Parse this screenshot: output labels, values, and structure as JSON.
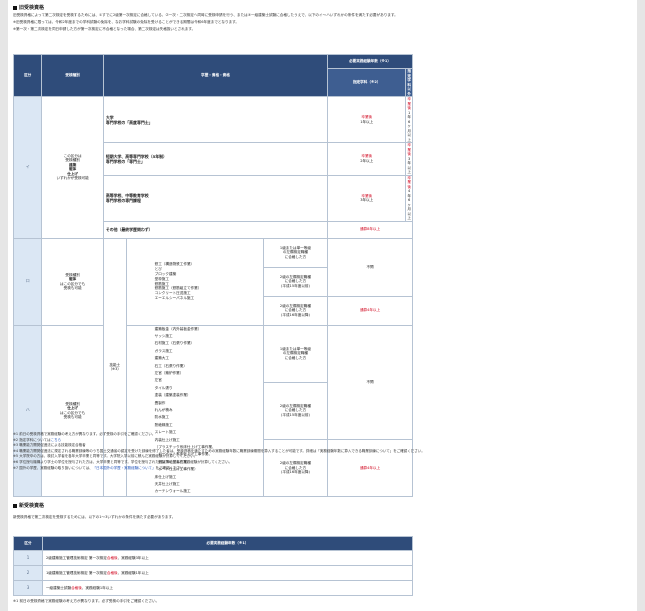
{
  "s1": {
    "title": "旧受検資格",
    "intro1": "旧受検資格によって第二次検定を受検するためには、①すでに2級第一次検定に合格している、②一次・二次検定へ同時に受検申請を行う、または③一級建築士試験に合格したうえで、以下のイ〜ハいずれかの条件を満たす必要があります。",
    "intro2": "※旧受検資格に限っては、令和2年度までの学科試験の免除を、なお学科試験の免除を受けることができる期間は令和6年度までとなります。",
    "intro3": "※第一次・第二次検定を同日申請した方が第一次検定に不合格となった場合、第二次検定は失格扱いとされます。"
  },
  "table1": {
    "h_kubun": "区分",
    "h_shubetsu": "受検種別",
    "h_gakureki": "学歴・資格・資格",
    "h_jitsumu": "必要実務経験年数（※1）",
    "h_shitei": "指定学科（※2）",
    "h_shitei_igai": "指定学科以外",
    "i_label": "イ",
    "i_shubetsu": [
      "この区分は",
      "受検種別",
      "建築",
      "躯体",
      "仕上げ",
      "いずれかが受検可能"
    ],
    "rows_i": [
      {
        "l1": "大学",
        "l2": "専門学校の「高度専門士」",
        "s_a": "卒業後",
        "s_b": "1年以上",
        "o_a": "卒業後",
        "o_b": "1年6ヶ月以上"
      },
      {
        "l1": "短期大学、高等専門学校（5年制）",
        "l2": "専門学校の「専門士」",
        "s_a": "卒業後",
        "s_b": "2年以上",
        "o_a": "卒業後",
        "o_b": "3年以上"
      },
      {
        "l1": "高等学校、中等教育学校",
        "l2": "専門学校の専門課程",
        "s_a": "卒業後",
        "s_b": "3年以上",
        "o_a": "卒業後",
        "o_b": "4年6ヶ月以上"
      }
    ],
    "sonota": "その他（最終学歴問わず）",
    "sonota_val": "通算8年以上",
    "ro_label": "ロ",
    "ro_shubetsu": [
      "受検種別",
      "躯体",
      "はこの区分でも",
      "受検も可能"
    ],
    "ha_label": "ハ",
    "ha_shubetsu": [
      "受検種別",
      "仕上げ",
      "はこの区分でも",
      "受検も可能"
    ],
    "ginou": [
      "技能士",
      "（※3）"
    ],
    "ro_trades": [
      "鉄工（構造物鉄工作業）",
      "とび",
      "ブロック建築",
      "型枠施工",
      "鉄筋施工",
      "鉄筋施工（鉄筋組立て作業）",
      "コンクリート圧送施工",
      "エーエルシーパネル施工"
    ],
    "ha_trades": [
      "建築板金（内外装板金作業）",
      "サッシ施工",
      "石材施工（石張り作業）",
      "ガラス施工",
      "建築大工",
      "石工（石張り作業）",
      "左官（築炉作業）",
      "左官",
      "タイル張り",
      "塗装（建築塗装作業）",
      "畳製作",
      "れんが積み",
      "防水施工",
      "熱絶縁施工",
      "スレート施工",
      "内装仕上げ施工",
      "（プラスチック系床仕上げ工事作業、",
      "　カーペット系床仕上げ工事作業、",
      "　鋼製下地工事作業、",
      "　ボード仕上げ工事作業）",
      "床仕上げ施工",
      "天井仕上げ施工",
      "カーテンウォール施工"
    ],
    "q1": [
      "1級または単一等級",
      "の左欄検定職種",
      "に合格した方"
    ],
    "q2": [
      "2級の左欄検定職種",
      "に合格した方",
      "(平成15年度以前)"
    ],
    "q3": [
      "2級の左欄検定職種",
      "に合格した方",
      "(平成16年度以降)"
    ],
    "fuyo": "不問",
    "tsusan4": "通算4年以上"
  },
  "notes1": [
    "※1 前日の受検資格で実務経験の考え方が異なります。必ず受検の手引をご確認ください。",
    "※2 指定学科については",
    "※3 職業能力開発促進法による技能検定合格者",
    "※4 職業能力開発促進法に規定される職業訓練等のうち国土交通省の認定を受けた訓練を修了した者は、受検資格を満たすための実務経験年数に職業訓練期間を算入することが可能です。詳細は「実務経験年数に算入できる職業訓練について」をご確認ください。",
    "※5 大学院卒の方は、検討入学者を各年大学卒業と同等です。大学院入学以前に積んだ実務経験が計算してください。",
    "※6 学位授与機構より学士の学位を授与された方は、大学卒業と同等です。学位を授与された日以降に積んだ実務経験が計算してください。",
    "※7 国外の学歴、実務経験の取り扱いについては、"
  ],
  "notes1_link2": "こちら",
  "notes1_link7": "「日本国外の学歴・実務経験について」",
  "notes1_tail7": "をご確認ください。",
  "s2": {
    "title": "新受検資格",
    "intro": "新受検資格で第二次検定を受検するためには、以下の1〜3いずれかの条件を満たす必要があります。"
  },
  "table2": {
    "h_kubun": "区分",
    "h_jitsumu": "必要実務経験年数（※1）",
    "rows": [
      {
        "n": "1",
        "a": "2級建築施工管理技術検定 第一次検定",
        "r": "合格後",
        "b": "、実務経験3年以上"
      },
      {
        "n": "2",
        "a": "1級建築施工管理技術検定 第一次検定",
        "r": "合格後",
        "b": "、実務経験1年以上"
      },
      {
        "n": "3",
        "a": "一級建築士試験",
        "r": "合格後",
        "b": "、実務経験1年以上"
      }
    ]
  },
  "notes2": "※1 前日の受検資格で実務経験の考え方が異なります。必ず受検の手引をご確認ください。"
}
